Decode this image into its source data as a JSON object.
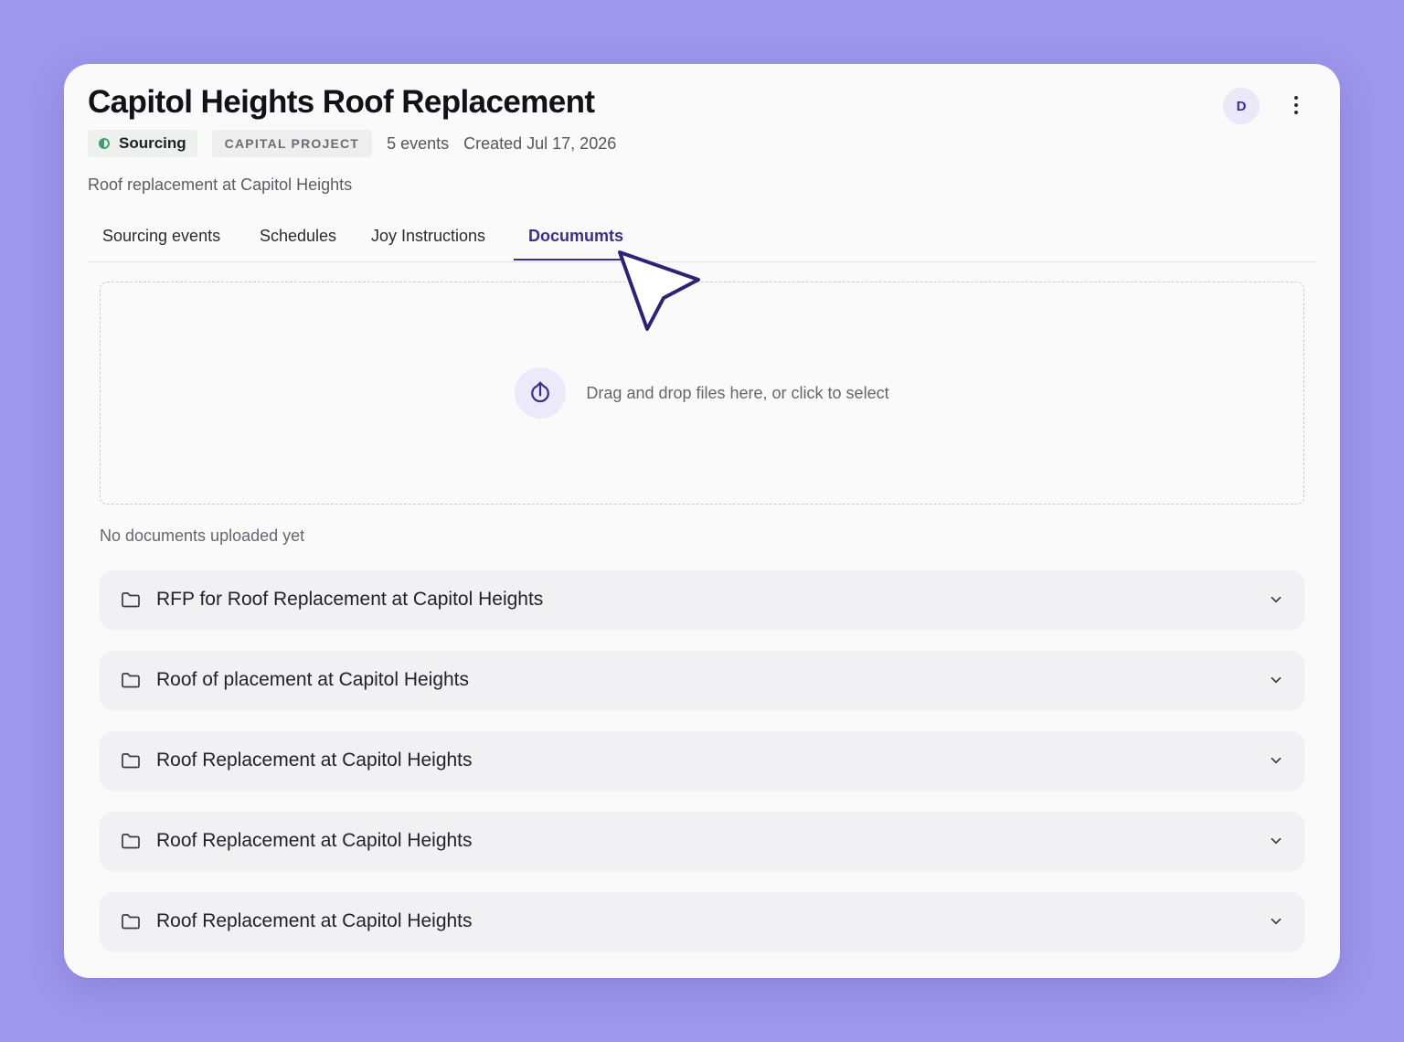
{
  "project": {
    "title": "Capitol Heights Roof Replacement",
    "status": "Sourcing",
    "type": "CAPITAL PROJECT",
    "events": "5 events",
    "created": "Created Jul 17, 2026",
    "description": "Roof replacement at Capitol Heights",
    "avatar_initial": "D"
  },
  "tabs": [
    {
      "label": "Sourcing events"
    },
    {
      "label": "Schedules"
    },
    {
      "label": "Joy Instructions"
    },
    {
      "label": "Documumts"
    }
  ],
  "active_tab": "Documumts",
  "dropzone": {
    "text": "Drag and drop files here, or click to select",
    "icon": "upload-icon"
  },
  "empty_note": "No documents uploaded yet",
  "folders": [
    {
      "label": "RFP for Roof Replacement at Capitol Heights"
    },
    {
      "label": "Roof of placement at Capitol Heights"
    },
    {
      "label": "Roof Replacement at Capitol Heights"
    },
    {
      "label": "Roof Replacement at Capitol Heights"
    },
    {
      "label": "Roof Replacement at Capitol Heights"
    }
  ],
  "colors": {
    "background": "#9f97ee",
    "accent": "#3b2f8a",
    "status": "#3f9f6a"
  }
}
